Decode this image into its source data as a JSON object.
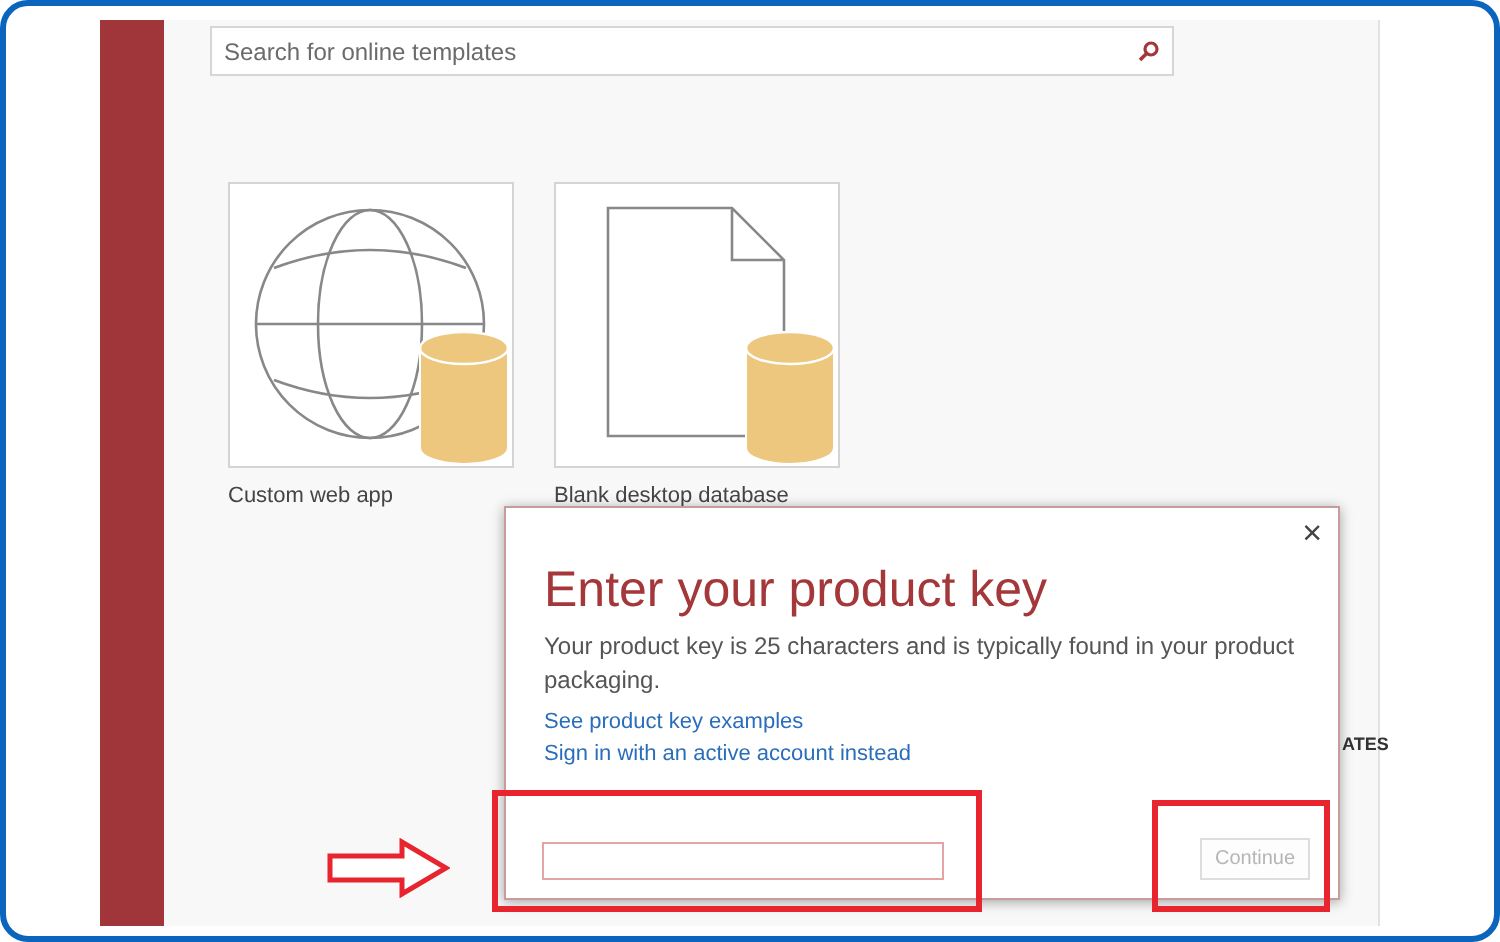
{
  "search": {
    "placeholder": "Search for online templates"
  },
  "templates": [
    {
      "kind": "web",
      "label": "Custom web app"
    },
    {
      "kind": "blank",
      "label": "Blank desktop database"
    }
  ],
  "section_heading_fragment": "ATES",
  "dialog": {
    "title": "Enter your product key",
    "description": "Your product key is 25 characters and is typically found in your product packaging.",
    "links": [
      "See product key examples",
      "Sign in with an active account instead"
    ],
    "close": "×",
    "continue_button": {
      "label": "Continue",
      "disabled": true
    }
  },
  "annotations": {
    "arrow": true,
    "highlight_key_field": true,
    "highlight_continue": true
  }
}
